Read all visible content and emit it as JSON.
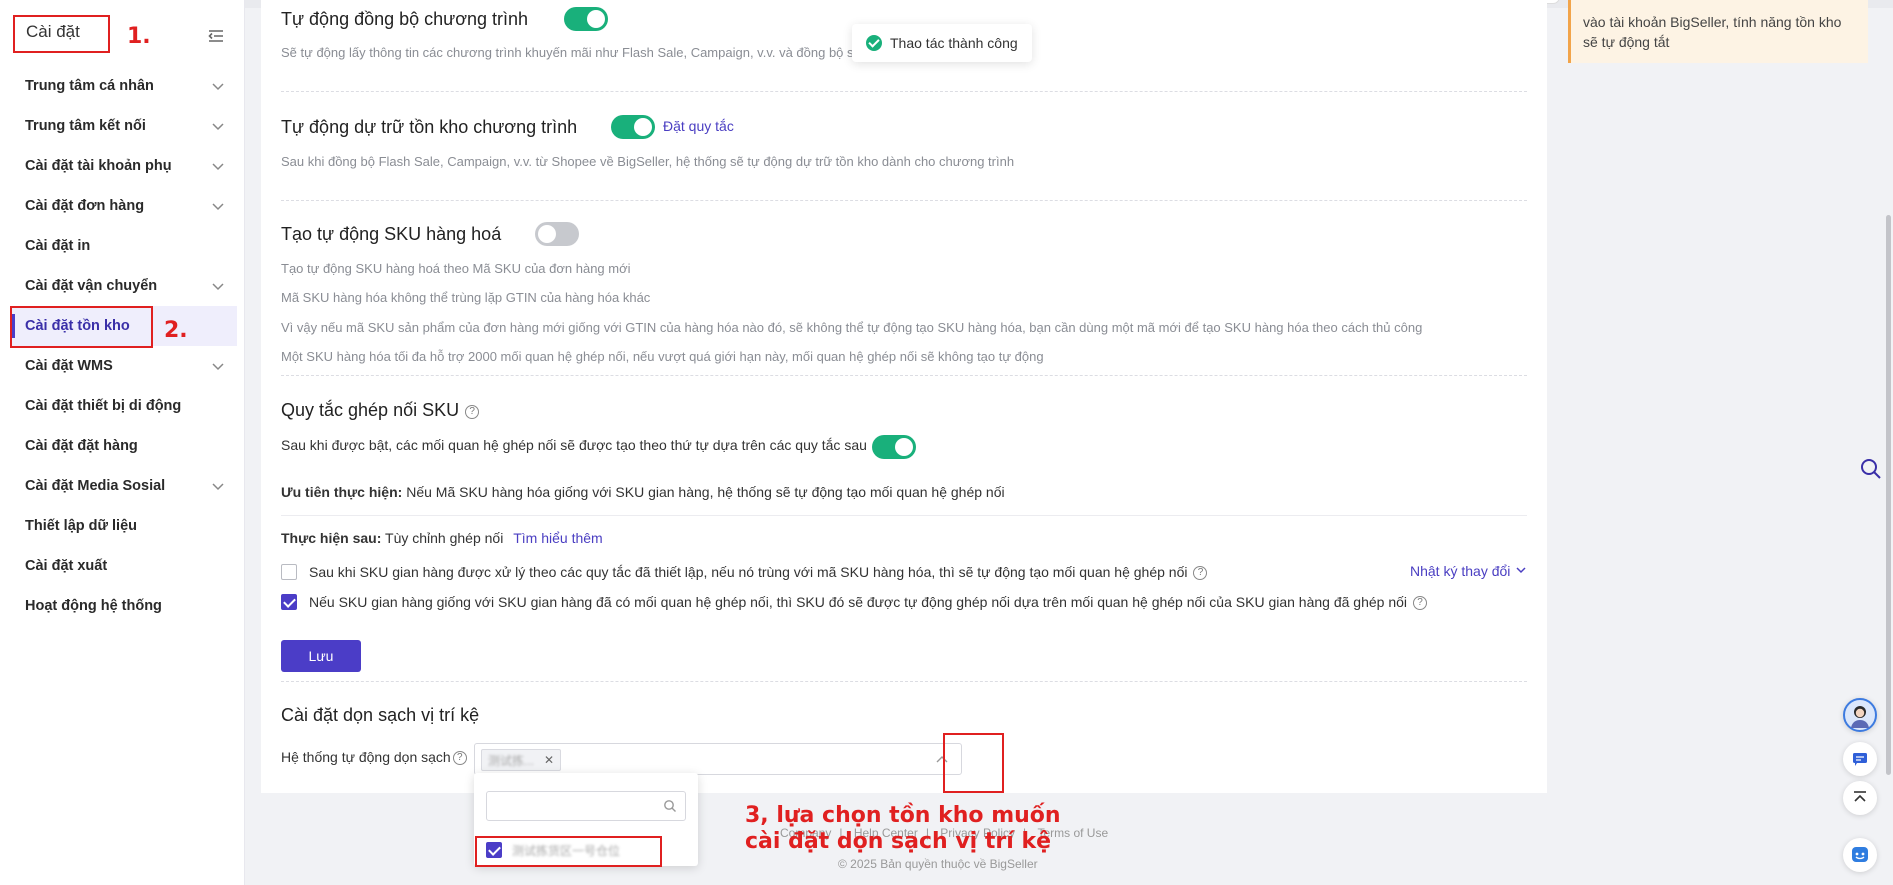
{
  "sidebar": {
    "title": "Cài đặt",
    "items": [
      {
        "label": "Trung tâm cá nhân",
        "chevron": true
      },
      {
        "label": "Trung tâm kết nối",
        "chevron": true
      },
      {
        "label": "Cài đặt tài khoản phụ",
        "chevron": true
      },
      {
        "label": "Cài đặt đơn hàng",
        "chevron": true
      },
      {
        "label": "Cài đặt in",
        "chevron": false
      },
      {
        "label": "Cài đặt vận chuyển",
        "chevron": true
      },
      {
        "label": "Cài đặt tồn kho",
        "chevron": false,
        "active": true
      },
      {
        "label": "Cài đặt WMS",
        "chevron": true
      },
      {
        "label": "Cài đặt thiết bị di động",
        "chevron": false
      },
      {
        "label": "Cài đặt đặt hàng",
        "chevron": false
      },
      {
        "label": "Cài đặt Media Sosial",
        "chevron": true
      },
      {
        "label": "Thiết lập dữ liệu",
        "chevron": false
      },
      {
        "label": "Cài đặt xuất",
        "chevron": false
      },
      {
        "label": "Hoạt động hệ thống",
        "chevron": false
      }
    ]
  },
  "toast": {
    "text": "Thao tác thành công"
  },
  "notice": {
    "text": "vào tài khoản BigSeller, tính năng tồn kho sẽ tự động tắt"
  },
  "sections": {
    "sync": {
      "title": "Tự động đồng bộ chương trình",
      "desc": "Sẽ tự động lấy thông tin các chương trình khuyến mãi như Flash Sale, Campaign, v.v. và đồng bộ sản"
    },
    "reserve": {
      "title": "Tự động dự trữ tồn kho chương trình",
      "link": "Đặt quy tắc",
      "desc": "Sau khi đồng bộ Flash Sale, Campaign, v.v. từ Shopee về BigSeller, hệ thống sẽ tự động dự trữ tồn kho dành cho chương trình"
    },
    "autosku": {
      "title": "Tạo tự động SKU hàng hoá",
      "lines": [
        "Tạo tự động SKU hàng hoá theo Mã SKU của đơn hàng mới",
        "Mã SKU hàng hóa không thể trùng lặp GTIN của hàng hóa khác",
        "Vì vậy nếu mã SKU sản phẩm của đơn hàng mới giống với GTIN của hàng hóa nào đó, sẽ không thể tự động tạo SKU hàng hóa, bạn cần dùng một mã mới để tạo SKU hàng hóa theo cách thủ công",
        "Một SKU hàng hóa tối đa hỗ trợ 2000 mối quan hệ ghép nối, nếu vượt quá giới hạn này, mối quan hệ ghép nối sẽ không tạo tự động"
      ]
    },
    "rules": {
      "title": "Quy tắc ghép nối SKU",
      "toggle_label": "Sau khi được bật, các mối quan hệ ghép nối sẽ được tạo theo thứ tự dựa trên các quy tắc sau",
      "priority_label": "Ưu tiên thực hiện:",
      "priority_text": "Nếu Mã SKU hàng hóa giống với SKU gian hàng, hệ thống sẽ tự động tạo mối quan hệ ghép nối",
      "after_label": "Thực hiện sau:",
      "after_text": "Tùy chỉnh ghép nối",
      "learn_more": "Tìm hiểu thêm",
      "changelog": "Nhật ký thay đổi",
      "option1": "Sau khi SKU gian hàng được xử lý theo các quy tắc đã thiết lập, nếu nó trùng với mã SKU hàng hóa, thì sẽ tự động tạo mối quan hệ ghép nối",
      "option2": "Nếu SKU gian hàng giống với SKU gian hàng đã có mối quan hệ ghép nối, thì SKU đó sẽ được tự động ghép nối dựa trên mối quan hệ ghép nối của SKU gian hàng đã ghép nối",
      "save": "Lưu"
    },
    "cleanup": {
      "title": "Cài đặt dọn sạch vị trí kệ",
      "field_label": "Hệ thống tự động dọn sạch",
      "tag": "测试拣...",
      "search_placeholder": "",
      "option": "测试拣货区一号仓位"
    }
  },
  "footer": {
    "links": [
      "Company",
      "Help Center",
      "Privacy Policy",
      "Terms of Use"
    ],
    "copyright": "© 2025 Bản quyền thuộc về BigSeller"
  },
  "annotations": {
    "a1": "1.",
    "a2": "2.",
    "a3_line1": "3, lựa chọn tồn kho muốn",
    "a3_line2": "cài đặt dọn sạch vị trí kệ"
  }
}
